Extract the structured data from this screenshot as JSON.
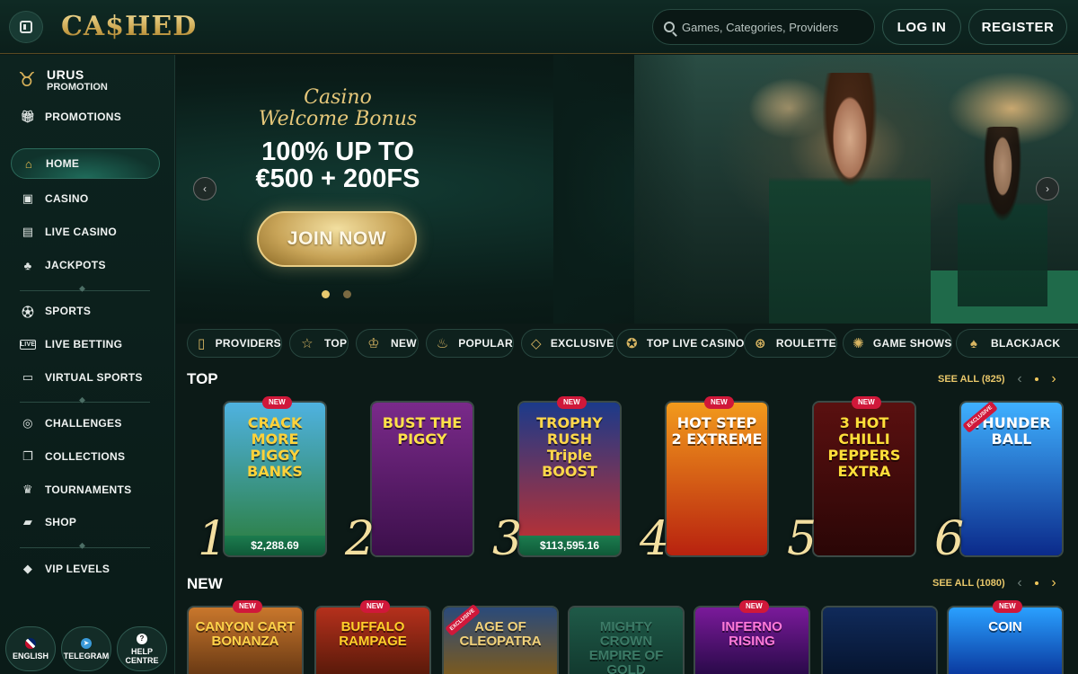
{
  "header": {
    "logo": "CA$HED",
    "search_placeholder": "Games, Categories, Providers",
    "login": "LOG IN",
    "register": "REGISTER"
  },
  "sidebar": {
    "promo_brand": "URUS",
    "promo_sub": "PROMOTION",
    "items": [
      {
        "label": "PROMOTIONS",
        "icon": "gift-icon"
      },
      {
        "label": "HOME",
        "icon": "home-icon",
        "active": true
      },
      {
        "label": "CASINO",
        "icon": "slot-machine-icon"
      },
      {
        "label": "LIVE CASINO",
        "icon": "live-cards-icon"
      },
      {
        "label": "JACKPOTS",
        "icon": "clover-icon"
      },
      {
        "label": "SPORTS",
        "icon": "soccer-ball-icon"
      },
      {
        "label": "LIVE BETTING",
        "icon": "live-badge-icon"
      },
      {
        "label": "VIRTUAL SPORTS",
        "icon": "virtual-sports-icon"
      },
      {
        "label": "CHALLENGES",
        "icon": "target-icon"
      },
      {
        "label": "COLLECTIONS",
        "icon": "cards-icon"
      },
      {
        "label": "TOURNAMENTS",
        "icon": "trophy-icon"
      },
      {
        "label": "SHOP",
        "icon": "shopping-bag-icon"
      },
      {
        "label": "VIP LEVELS",
        "icon": "diamond-icon"
      }
    ],
    "bottom": [
      {
        "label": "ENGLISH",
        "icon": "uk-flag-icon"
      },
      {
        "label": "TELEGRAM",
        "icon": "telegram-icon"
      },
      {
        "label": "HELP CENTRE",
        "icon": "help-icon"
      }
    ]
  },
  "hero": {
    "title_script": "Casino Welcome Bonus",
    "bonus_line1": "100% UP TO",
    "bonus_line2": "€500 + 200FS",
    "cta": "JOIN NOW",
    "active_slide": 1,
    "slide_count": 2
  },
  "categories": [
    {
      "label": "PROVIDERS",
      "icon": "book-icon"
    },
    {
      "label": "TOP",
      "icon": "star-icon"
    },
    {
      "label": "NEW",
      "icon": "crown-icon"
    },
    {
      "label": "POPULAR",
      "icon": "flame-icon"
    },
    {
      "label": "EXCLUSIVE",
      "icon": "diamond-icon"
    },
    {
      "label": "TOP LIVE CASINO",
      "icon": "medal-icon"
    },
    {
      "label": "ROULETTE",
      "icon": "roulette-icon"
    },
    {
      "label": "GAME SHOWS",
      "icon": "wheel-icon"
    },
    {
      "label": "BLACKJACK",
      "icon": "playing-cards-icon"
    }
  ],
  "top_section": {
    "title": "TOP",
    "see_all": "SEE ALL (825)",
    "games": [
      {
        "rank": "1",
        "title": "CRACK MORE PIGGY BANKS",
        "badge": "NEW",
        "jackpot": "$2,288.69",
        "bg1": "#4fb2e0",
        "bg2": "#2a7c3a",
        "text_color": "#ffd23a"
      },
      {
        "rank": "2",
        "title": "BUST THE PIGGY",
        "badge": "",
        "jackpot": "",
        "bg1": "#7a2a8a",
        "bg2": "#3b0f4a",
        "text_color": "#ffe14a"
      },
      {
        "rank": "3",
        "title": "TROPHY RUSH Triple BOOST",
        "badge": "NEW",
        "jackpot": "$113,595.16",
        "bg1": "#1b3a8a",
        "bg2": "#c9302c",
        "text_color": "#ffd84a"
      },
      {
        "rank": "4",
        "title": "HOT STEP 2 EXTREME",
        "badge": "NEW",
        "jackpot": "",
        "bg1": "#f29a1c",
        "bg2": "#b8220f",
        "text_color": "#ffffff"
      },
      {
        "rank": "5",
        "title": "3 HOT CHILLI PEPPERS EXTRA",
        "badge": "NEW",
        "jackpot": "",
        "bg1": "#5a1010",
        "bg2": "#2a0606",
        "text_color": "#ffdf3a"
      },
      {
        "rank": "6",
        "title": "THUNDER BALL",
        "badge": "EXCLUSIVE",
        "jackpot": "",
        "bg1": "#3fb0ff",
        "bg2": "#0b2a8a",
        "text_color": "#ffffff"
      }
    ]
  },
  "new_section": {
    "title": "NEW",
    "see_all": "SEE ALL (1080)",
    "games": [
      {
        "title": "CANYON CART BONANZA",
        "badge": "NEW",
        "bg1": "#c9772c",
        "bg2": "#6a3a14",
        "text_color": "#ffd34a"
      },
      {
        "title": "BUFFALO RAMPAGE",
        "badge": "NEW",
        "bg1": "#b5301c",
        "bg2": "#5a1a0a",
        "text_color": "#ffcf2a"
      },
      {
        "title": "AGE OF CLEOPATRA",
        "badge": "EXCLUSIVE",
        "bg1": "#2a4a7a",
        "bg2": "#7a5a20",
        "text_color": "#f2d27a"
      },
      {
        "title": "MIGHTY CROWN EMPIRE OF GOLD",
        "badge": "",
        "bg1": "#1f5a48",
        "bg2": "#123a2f",
        "text_color": "#3c7a66"
      },
      {
        "title": "INFERNO RISING",
        "badge": "NEW",
        "bg1": "#7a1a9a",
        "bg2": "#2a0a4a",
        "text_color": "#ff7ad8"
      },
      {
        "title": "",
        "badge": "",
        "bg1": "#102a5a",
        "bg2": "#061530",
        "text_color": "#ffffff"
      },
      {
        "title": "COIN",
        "badge": "NEW",
        "bg1": "#2aa0ff",
        "bg2": "#0a3aa0",
        "text_color": "#ffffff"
      }
    ]
  },
  "colors": {
    "accent_gold": "#e8c76a",
    "badge_red": "#d0183a",
    "panel": "#0e211d"
  }
}
